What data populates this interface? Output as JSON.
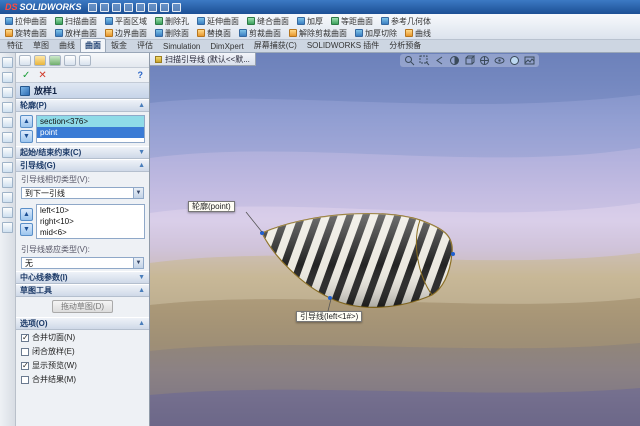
{
  "glyphs": {
    "collapse": "▲",
    "expand": "▼",
    "dropdown": "▼",
    "up": "▲",
    "down": "▼",
    "ok": "✓",
    "cancel": "✕",
    "help": "?"
  },
  "titlebar": {
    "logo_ds": "DS",
    "logo_rest": "SOLIDWORKS",
    "quick_icons": [
      {
        "name": "new-icon"
      },
      {
        "name": "open-icon"
      },
      {
        "name": "save-icon"
      },
      {
        "name": "print-icon"
      },
      {
        "name": "undo-icon"
      },
      {
        "name": "redo-icon"
      },
      {
        "name": "rebuild-icon"
      },
      {
        "name": "options-icon"
      }
    ]
  },
  "ribbon": {
    "row1": [
      {
        "label": "拉伸曲面"
      },
      {
        "label": "扫描曲面"
      },
      {
        "label": "平面区域"
      },
      {
        "label": "删除孔"
      },
      {
        "label": "延伸曲面"
      },
      {
        "label": "缝合曲面"
      },
      {
        "label": "加厚"
      },
      {
        "label": "等距曲面"
      },
      {
        "label": "参考几何体"
      }
    ],
    "row2": [
      {
        "label": "旋转曲面"
      },
      {
        "label": "放样曲面"
      },
      {
        "label": "边界曲面"
      },
      {
        "label": "删除面"
      },
      {
        "label": "替换面"
      },
      {
        "label": "剪裁曲面"
      },
      {
        "label": "解除剪裁曲面"
      },
      {
        "label": "加厚切除"
      },
      {
        "label": "曲线"
      }
    ]
  },
  "tabs": {
    "items": [
      {
        "label": "特征"
      },
      {
        "label": "草图"
      },
      {
        "label": "曲线"
      },
      {
        "label": "曲面",
        "active": true
      },
      {
        "label": "钣金"
      },
      {
        "label": "评估"
      },
      {
        "label": "Simulation"
      },
      {
        "label": "DimXpert"
      },
      {
        "label": "屏幕捕获(C)"
      },
      {
        "label": "SOLIDWORKS 插件"
      },
      {
        "label": "分析预备"
      }
    ]
  },
  "left_toolbar": {
    "icons": [
      {
        "name": "sketch-icon"
      },
      {
        "name": "extrude-surface-icon"
      },
      {
        "name": "revolve-surface-icon"
      },
      {
        "name": "sweep-surface-icon"
      },
      {
        "name": "loft-surface-icon"
      },
      {
        "name": "boundary-surface-icon"
      },
      {
        "name": "planar-surface-icon"
      },
      {
        "name": "offset-surface-icon"
      },
      {
        "name": "knit-surface-icon"
      },
      {
        "name": "trim-surface-icon"
      },
      {
        "name": "extend-surface-icon"
      },
      {
        "name": "thicken-icon"
      }
    ]
  },
  "property_manager": {
    "title": "放样1",
    "sections": {
      "profiles": {
        "header": "轮廓(P)",
        "items": [
          {
            "label": "section<376>",
            "cyan": true
          },
          {
            "label": "point",
            "selected": true
          }
        ]
      },
      "start_end": {
        "header": "起始/结束约束(C)"
      },
      "guide_curves": {
        "header": "引导线(G)",
        "tangency_label": "引导线相切类型(V):",
        "tangency_value": "到下一引线",
        "items": [
          {
            "label": "left<10>"
          },
          {
            "label": "right<10>"
          },
          {
            "label": "mid<6>"
          }
        ],
        "influence_label": "引导线感应类型(V):",
        "influence_value": "无"
      },
      "centerline": {
        "header": "中心线参数(I)"
      },
      "sketch_tools": {
        "header": "草图工具",
        "drag_button": "拖动草图(D)"
      },
      "options": {
        "header": "选项(O)",
        "checks": [
          {
            "label": "合并切面(N)",
            "checked": true
          },
          {
            "label": "闭合放样(E)"
          },
          {
            "label": "显示预览(W)",
            "checked": true
          },
          {
            "label": "合并结果(M)"
          }
        ]
      }
    }
  },
  "viewport": {
    "doc_tab": "扫描引导线 (默认<<默...",
    "callout_profile": "轮廓(point)",
    "callout_guide": "引导线(left<1#>)"
  }
}
